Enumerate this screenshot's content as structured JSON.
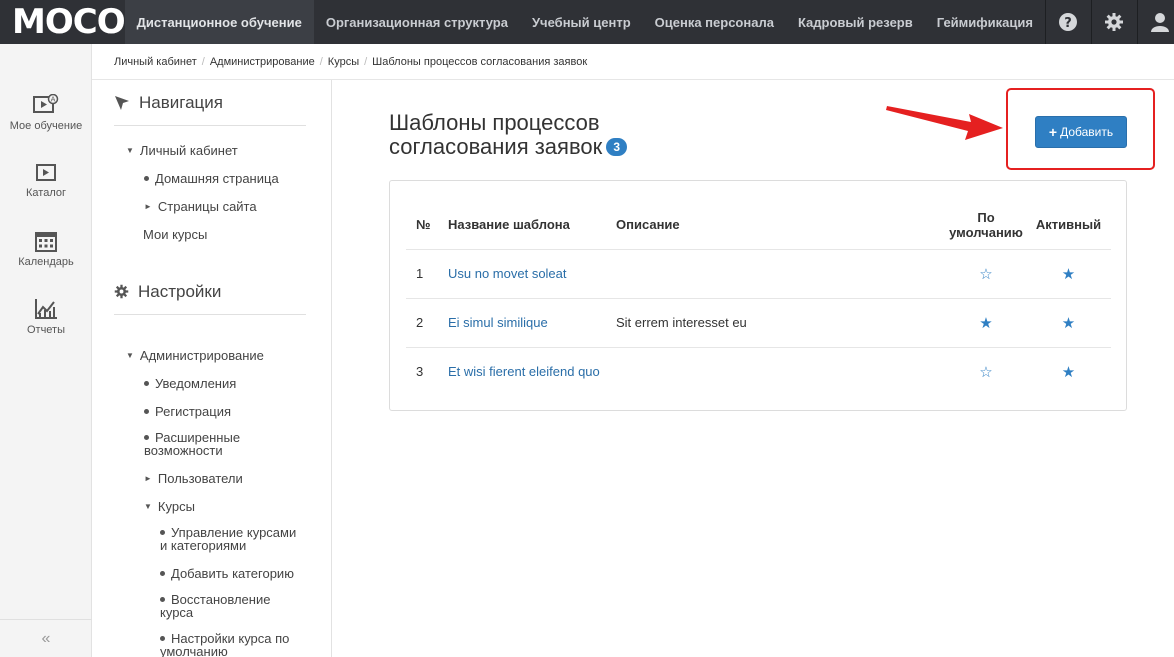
{
  "top_nav": {
    "logo": "MOCO",
    "items": [
      {
        "label": "Дистанционное обучение",
        "active": true
      },
      {
        "label": "Организационная структура",
        "active": false
      },
      {
        "label": "Учебный центр",
        "active": false
      },
      {
        "label": "Оценка персонала",
        "active": false
      },
      {
        "label": "Кадровый резерв",
        "active": false
      },
      {
        "label": "Геймификация",
        "active": false
      }
    ],
    "icons": [
      "help-icon",
      "gear-icon",
      "user-icon"
    ]
  },
  "rail": {
    "items": [
      {
        "label": "Мое обучение",
        "icon": "learning-icon"
      },
      {
        "label": "Каталог",
        "icon": "catalog-icon"
      },
      {
        "label": "Календарь",
        "icon": "calendar-icon"
      },
      {
        "label": "Отчеты",
        "icon": "reports-icon"
      }
    ],
    "collapse": "«"
  },
  "breadcrumb": {
    "items": [
      "Личный кабинет",
      "Администрирование",
      "Курсы"
    ],
    "current": "Шаблоны процессов согласования заявок"
  },
  "sidebar": {
    "nav_title": "Навигация",
    "cabinet": "Личный кабинет",
    "home": "Домашняя страница",
    "site_pages": "Страницы сайта",
    "my_courses": "Мои курсы",
    "settings_title": "Настройки",
    "admin": "Администрирование",
    "notifications": "Уведомления",
    "registration": "Регистрация",
    "extended_1": "Расширенные",
    "extended_2": "возможности",
    "users": "Пользователи",
    "courses": "Курсы",
    "manage_1": "Управление курсами",
    "manage_2": "и категориями",
    "add_category": "Добавить категорию",
    "restore_1": "Восстановление",
    "restore_2": "курса",
    "defaults_1": "Настройки курса по",
    "defaults_2": "умолчанию"
  },
  "main": {
    "title_line1": "Шаблоны процессов",
    "title_line2": "согласования заявок",
    "count": "3",
    "add_button": "Добавить",
    "table": {
      "headers": {
        "num": "№",
        "name": "Название шаблона",
        "desc": "Описание",
        "default_1": "По",
        "default_2": "умолчанию",
        "active": "Активный"
      },
      "rows": [
        {
          "num": "1",
          "name": "Usu no movet soleat",
          "desc": "",
          "default": false,
          "active": true
        },
        {
          "num": "2",
          "name": "Ei simul similique",
          "desc": "Sit errem interesset eu",
          "default": true,
          "active": true
        },
        {
          "num": "3",
          "name": "Et wisi fierent eleifend quo",
          "desc": "",
          "default": false,
          "active": true
        }
      ]
    }
  },
  "colors": {
    "accent": "#2f7fc3",
    "topbar": "#2f3136",
    "highlight": "#e52020"
  }
}
